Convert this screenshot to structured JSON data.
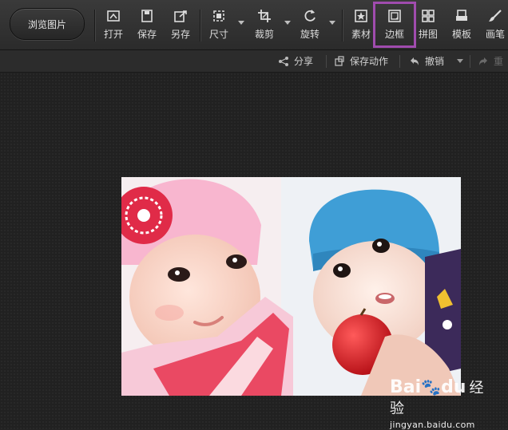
{
  "toolbar": {
    "browse_label": "浏览图片",
    "tools": [
      {
        "label": "打开",
        "icon": "open-icon"
      },
      {
        "label": "保存",
        "icon": "save-icon"
      },
      {
        "label": "另存",
        "icon": "save-as-icon"
      },
      {
        "label": "尺寸",
        "icon": "resize-icon"
      },
      {
        "label": "裁剪",
        "icon": "crop-icon"
      },
      {
        "label": "旋转",
        "icon": "rotate-icon"
      },
      {
        "label": "素材",
        "icon": "material-icon"
      },
      {
        "label": "边框",
        "icon": "border-icon",
        "active": true
      },
      {
        "label": "拼图",
        "icon": "collage-icon"
      },
      {
        "label": "模板",
        "icon": "template-icon"
      },
      {
        "label": "画笔",
        "icon": "brush-icon"
      }
    ],
    "highlight_color": "#a04cae"
  },
  "subbar": {
    "share_label": "分享",
    "save_action_label": "保存动作",
    "undo_label": "撤销",
    "redo_label": "重"
  },
  "photo": {
    "description_icon": "photo-two-babies"
  },
  "watermark": {
    "logo": "Bai",
    "logo_suffix": "du",
    "cn": "经验",
    "url": "jingyan.baidu.com"
  }
}
